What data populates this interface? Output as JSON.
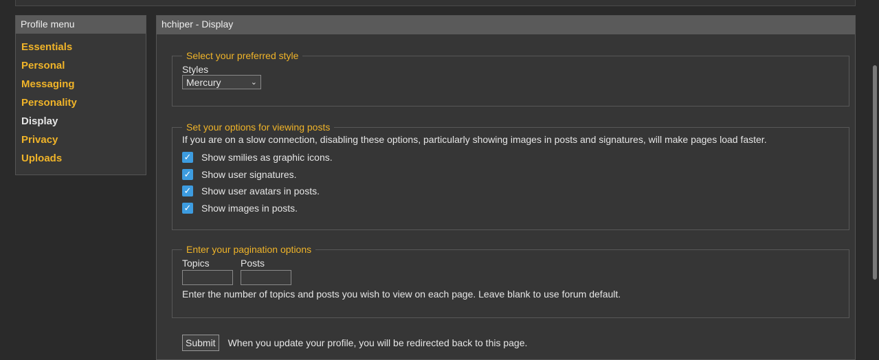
{
  "sidebar": {
    "title": "Profile menu",
    "items": [
      {
        "label": "Essentials"
      },
      {
        "label": "Personal"
      },
      {
        "label": "Messaging"
      },
      {
        "label": "Personality"
      },
      {
        "label": "Display"
      },
      {
        "label": "Privacy"
      },
      {
        "label": "Uploads"
      }
    ],
    "active": "Display"
  },
  "main": {
    "title": "hchiper - Display",
    "style_section": {
      "legend": "Select your preferred style",
      "label": "Styles",
      "selected": "Mercury"
    },
    "view_section": {
      "legend": "Set your options for viewing posts",
      "description": "If you are on a slow connection, disabling these options, particularly showing images in posts and signatures, will make pages load faster.",
      "options": [
        {
          "label": "Show smilies as graphic icons.",
          "checked": true
        },
        {
          "label": "Show user signatures.",
          "checked": true
        },
        {
          "label": "Show user avatars in posts.",
          "checked": true
        },
        {
          "label": "Show images in posts.",
          "checked": true
        }
      ]
    },
    "pagination_section": {
      "legend": "Enter your pagination options",
      "topics_label": "Topics",
      "topics_value": "",
      "posts_label": "Posts",
      "posts_value": "",
      "help": "Enter the number of topics and posts you wish to view on each page. Leave blank to use forum default."
    },
    "submit": {
      "label": "Submit",
      "note": "When you update your profile, you will be redirected back to this page."
    }
  },
  "colors": {
    "accent": "#f0b429",
    "checkbox": "#3d9ce0",
    "background": "#2a2a2a",
    "header": "#5a5a5a"
  }
}
